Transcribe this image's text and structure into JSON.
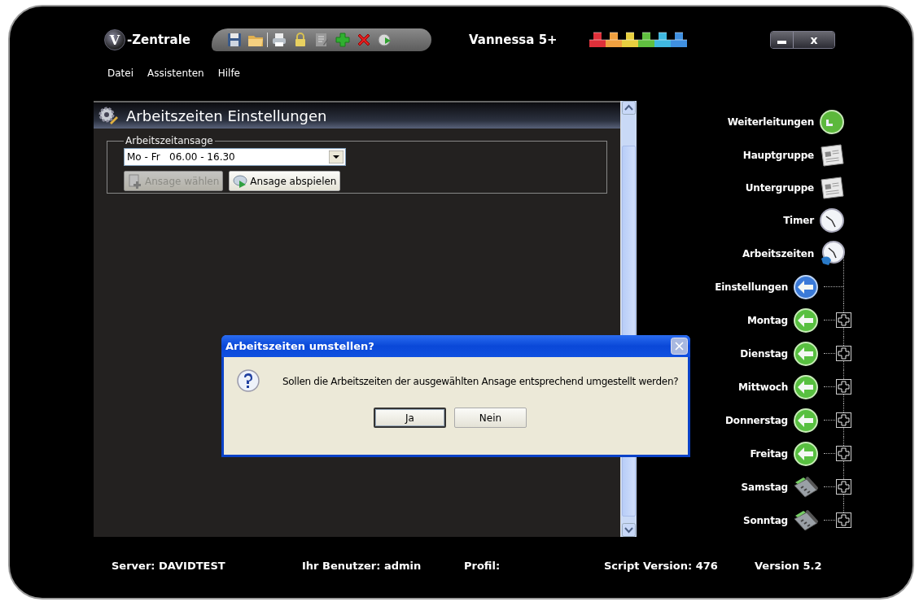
{
  "app": {
    "logo_mark": "V",
    "title": "-Zentrale",
    "product": "Vannessa 5+"
  },
  "toolbar": [
    {
      "kind": "save"
    },
    {
      "kind": "folder"
    },
    {
      "kind": "separator"
    },
    {
      "kind": "printer"
    },
    {
      "kind": "lock"
    },
    {
      "kind": "notepad"
    },
    {
      "kind": "add"
    },
    {
      "kind": "delete"
    },
    {
      "kind": "play"
    }
  ],
  "modules": [
    {
      "color": "#e0303a"
    },
    {
      "color": "#f0a040"
    },
    {
      "color": "#e8d040"
    },
    {
      "color": "#60c040"
    },
    {
      "color": "#40b8e0"
    },
    {
      "color": "#4090e0"
    }
  ],
  "window_controls": {
    "close": "x"
  },
  "menu": [
    "Datei",
    "Assistenten",
    "Hilfe"
  ],
  "panel": {
    "title": "Arbeitszeiten Einstellungen",
    "group": {
      "legend": "Arbeitszeitansage",
      "select_value": "Mo - Fr   06.00 - 16.30",
      "buttons": [
        {
          "label": "Ansage wählen",
          "kind": "add",
          "disabled": true
        },
        {
          "label": "Ansage abspielen",
          "kind": "play",
          "disabled": false
        }
      ]
    }
  },
  "nav": [
    {
      "label": "Weiterleitungen",
      "kind": "forward"
    },
    {
      "label": "Hauptgruppe",
      "kind": "newspaper"
    },
    {
      "label": "Untergruppe",
      "kind": "newspaper"
    },
    {
      "label": "Timer",
      "kind": "clock"
    },
    {
      "label": "Arbeitszeiten",
      "kind": "clock-open",
      "expanded": true,
      "children": [
        {
          "label": "Einstellungen",
          "kind": "arrow",
          "selected": true,
          "expandable": false
        },
        {
          "label": "Montag",
          "kind": "arrow",
          "selected": false,
          "expandable": true
        },
        {
          "label": "Dienstag",
          "kind": "arrow",
          "selected": false,
          "expandable": true
        },
        {
          "label": "Mittwoch",
          "kind": "arrow",
          "selected": false,
          "expandable": true
        },
        {
          "label": "Donnerstag",
          "kind": "arrow",
          "selected": false,
          "expandable": true
        },
        {
          "label": "Freitag",
          "kind": "arrow",
          "selected": false,
          "expandable": true
        },
        {
          "label": "Samstag",
          "kind": "phone",
          "selected": false,
          "expandable": true
        },
        {
          "label": "Sonntag",
          "kind": "phone",
          "selected": false,
          "expandable": true
        }
      ]
    }
  ],
  "dialog": {
    "title": "Arbeitszeiten umstellen?",
    "message": "Sollen die Arbeitszeiten der ausgewählten Ansage entsprechend umgestellt werden?",
    "buttons": [
      {
        "label": "Ja",
        "default": true
      },
      {
        "label": "Nein",
        "default": false
      }
    ]
  },
  "status_bar": [
    "Server: DAVIDTEST",
    "Ihr Benutzer: admin",
    "Profil:",
    "Script Version: 476",
    "Version 5.2"
  ]
}
